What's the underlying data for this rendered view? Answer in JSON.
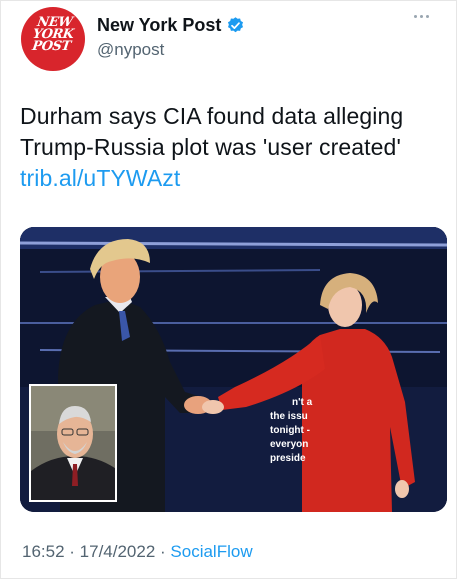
{
  "account": {
    "display_name": "New York Post",
    "handle": "@nypost",
    "avatar_lines": [
      "NEW",
      "YORK",
      "POST"
    ],
    "verified": true,
    "verified_icon": "verified-badge-icon",
    "more_icon": "more-dots-icon"
  },
  "tweet": {
    "text": "Durham says CIA found data alleging Trump-Russia plot was 'user created' ",
    "link": "trib.al/uTYWAzt"
  },
  "media": {
    "podium_text": [
      "n't a",
      "the issu",
      "tonight -",
      "everyon",
      "preside"
    ]
  },
  "meta": {
    "time": "16:52",
    "separator": " · ",
    "date": "17/4/2022",
    "source": "SocialFlow"
  },
  "colors": {
    "link": "#1d9bf0",
    "secondary_text": "#536471",
    "brand_red": "#d8252c",
    "stage_navy": "#0d1530"
  }
}
